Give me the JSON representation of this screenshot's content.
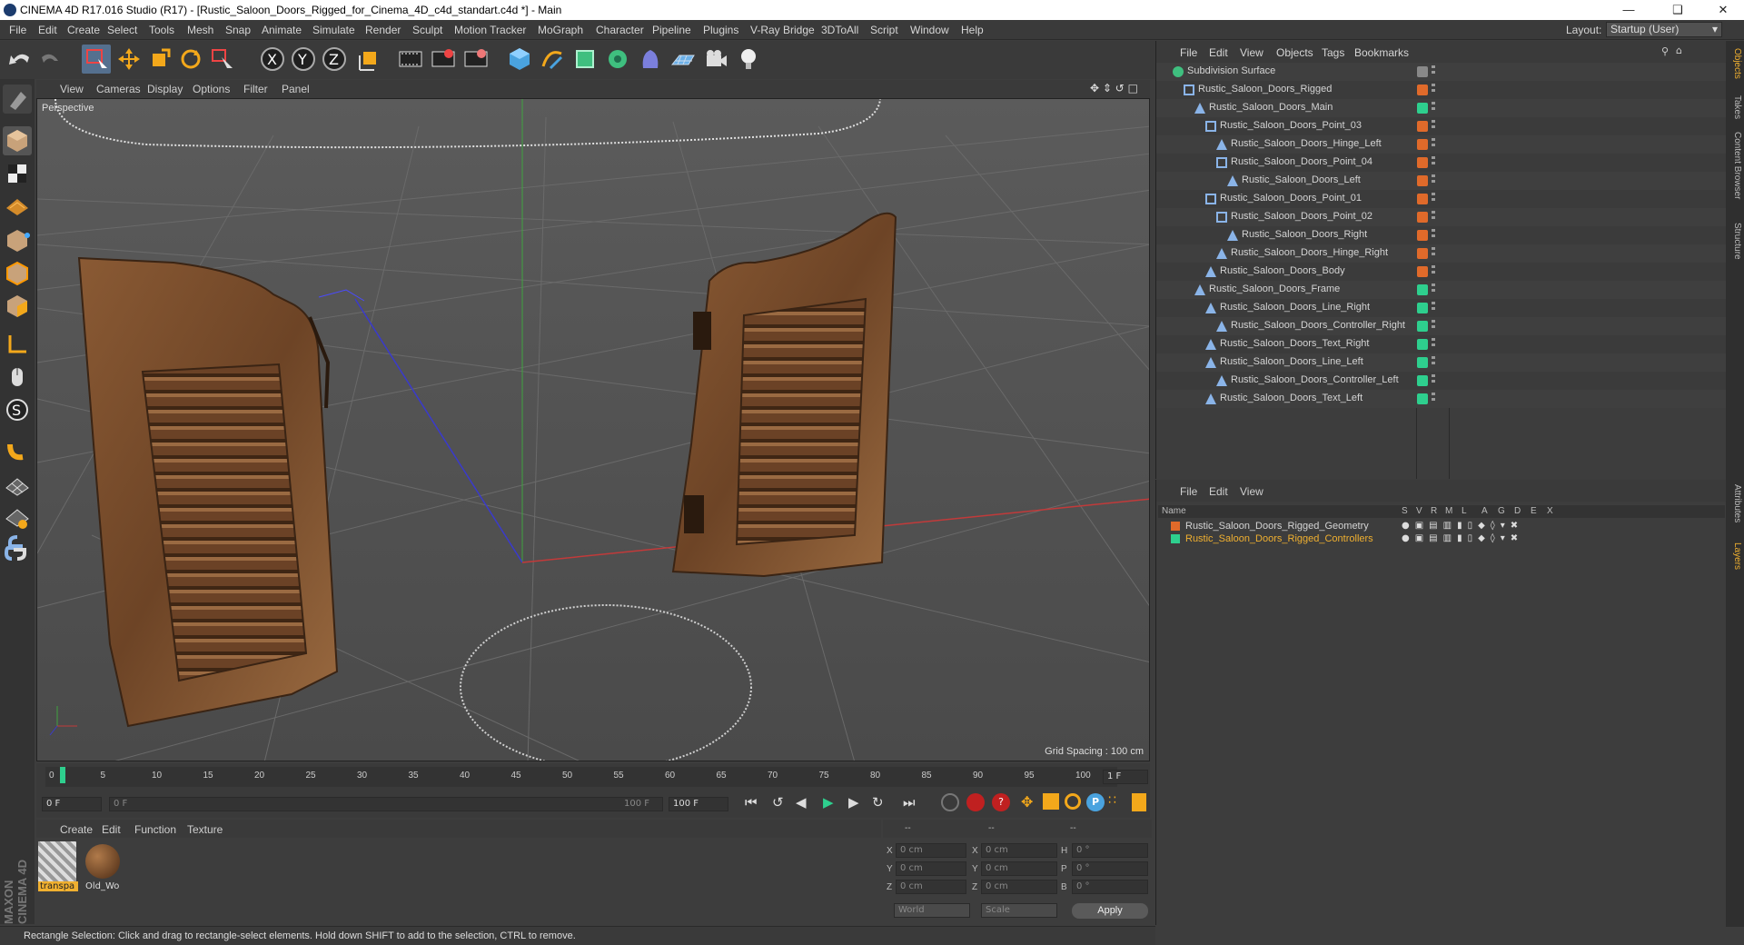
{
  "window": {
    "title": "CINEMA 4D R17.016 Studio (R17) - [Rustic_Saloon_Doors_Rigged_for_Cinema_4D_c4d_standart.c4d *] - Main"
  },
  "menubar": {
    "items": [
      "File",
      "Edit",
      "Create",
      "Select",
      "Tools",
      "Mesh",
      "Snap",
      "Animate",
      "Simulate",
      "Render",
      "Sculpt",
      "Motion Tracker",
      "MoGraph",
      "Character",
      "Pipeline",
      "Plugins",
      "V-Ray Bridge",
      "3DToAll",
      "Script",
      "Window",
      "Help"
    ],
    "layout_label": "Layout:",
    "layout_value": "Startup (User)"
  },
  "viewport": {
    "menu": [
      "View",
      "Cameras",
      "Display",
      "Options",
      "Filter",
      "Panel"
    ],
    "camera": "Perspective",
    "grid_spacing": "Grid Spacing : 100 cm"
  },
  "timeline": {
    "ticks": [
      "0",
      "5",
      "10",
      "15",
      "20",
      "25",
      "30",
      "35",
      "40",
      "45",
      "50",
      "55",
      "60",
      "65",
      "70",
      "75",
      "80",
      "85",
      "90",
      "95",
      "100"
    ],
    "current_frame": "1 F",
    "start": "0 F",
    "range_left": "0 F",
    "range_right": "100 F",
    "end": "100 F"
  },
  "materials": {
    "menu": [
      "Create",
      "Edit",
      "Function",
      "Texture"
    ],
    "items": [
      {
        "label": "transpa"
      },
      {
        "label": "Old_Wo"
      }
    ]
  },
  "coords": {
    "headers": [
      "--",
      "--",
      "--"
    ],
    "rows": [
      {
        "a": "X",
        "av": "0 cm",
        "b": "X",
        "bv": "0 cm",
        "c": "H",
        "cv": "0 °"
      },
      {
        "a": "Y",
        "av": "0 cm",
        "b": "Y",
        "bv": "0 cm",
        "c": "P",
        "cv": "0 °"
      },
      {
        "a": "Z",
        "av": "0 cm",
        "b": "Z",
        "bv": "0 cm",
        "c": "B",
        "cv": "0 °"
      }
    ],
    "world": "World",
    "scale": "Scale",
    "apply": "Apply"
  },
  "status": "Rectangle Selection: Click and drag to rectangle-select elements. Hold down SHIFT to add to the selection, CTRL to remove.",
  "objects": {
    "menu": [
      "File",
      "Edit",
      "View",
      "Objects",
      "Tags",
      "Bookmarks"
    ],
    "rows": [
      {
        "name": "Subdivision Surface",
        "color": "#888888"
      },
      {
        "name": "Rustic_Saloon_Doors_Rigged",
        "color": "#e06a2a"
      },
      {
        "name": "Rustic_Saloon_Doors_Main",
        "color": "#2ecf8e"
      },
      {
        "name": "Rustic_Saloon_Doors_Point_03",
        "color": "#e06a2a"
      },
      {
        "name": "Rustic_Saloon_Doors_Hinge_Left",
        "color": "#e06a2a"
      },
      {
        "name": "Rustic_Saloon_Doors_Point_04",
        "color": "#e06a2a"
      },
      {
        "name": "Rustic_Saloon_Doors_Left",
        "color": "#e06a2a"
      },
      {
        "name": "Rustic_Saloon_Doors_Point_01",
        "color": "#e06a2a"
      },
      {
        "name": "Rustic_Saloon_Doors_Point_02",
        "color": "#e06a2a"
      },
      {
        "name": "Rustic_Saloon_Doors_Right",
        "color": "#e06a2a"
      },
      {
        "name": "Rustic_Saloon_Doors_Hinge_Right",
        "color": "#e06a2a"
      },
      {
        "name": "Rustic_Saloon_Doors_Body",
        "color": "#e06a2a"
      },
      {
        "name": "Rustic_Saloon_Doors_Frame",
        "color": "#2ecf8e"
      },
      {
        "name": "Rustic_Saloon_Doors_Line_Right",
        "color": "#2ecf8e"
      },
      {
        "name": "Rustic_Saloon_Doors_Controller_Right",
        "color": "#2ecf8e"
      },
      {
        "name": "Rustic_Saloon_Doors_Text_Right",
        "color": "#2ecf8e"
      },
      {
        "name": "Rustic_Saloon_Doors_Line_Left",
        "color": "#2ecf8e"
      },
      {
        "name": "Rustic_Saloon_Doors_Controller_Left",
        "color": "#2ecf8e"
      },
      {
        "name": "Rustic_Saloon_Doors_Text_Left",
        "color": "#2ecf8e"
      }
    ]
  },
  "layers": {
    "menu": [
      "File",
      "Edit",
      "View"
    ],
    "columns": [
      "Name",
      "S",
      "V",
      "R",
      "M",
      "L",
      "A",
      "G",
      "D",
      "E",
      "X"
    ],
    "rows": [
      {
        "name": "Rustic_Saloon_Doors_Rigged_Geometry",
        "color": "#e06a2a",
        "text_color": "#d4d4d4"
      },
      {
        "name": "Rustic_Saloon_Doors_Rigged_Controllers",
        "color": "#2ecf8e",
        "text_color": "#f0b030"
      }
    ]
  },
  "right_tabs": [
    "Objects",
    "Takes",
    "Content Browser",
    "Structure",
    "Attributes",
    "Layers"
  ],
  "colors": {
    "accent": "#f0b030",
    "green": "#2ecf8e",
    "orange": "#e06a2a"
  }
}
